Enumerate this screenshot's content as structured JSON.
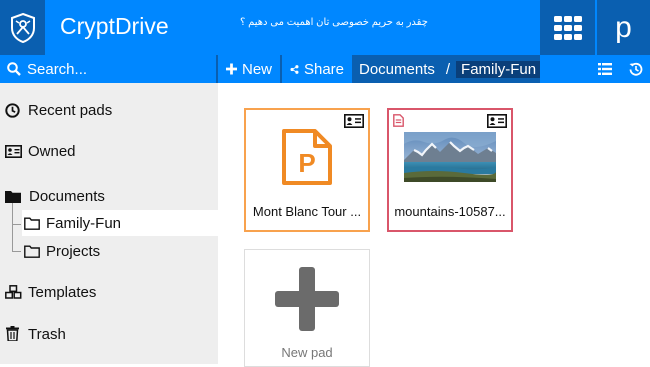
{
  "header": {
    "app_title": "CryptDrive",
    "motto": "چقدر به حریم خصوصی تان اهمیت می دهیم ؟",
    "user_initial": "p"
  },
  "toolbar": {
    "search_placeholder": "Search...",
    "new_label": "New",
    "share_label": "Share",
    "breadcrumb": [
      "Documents",
      "Family-Fun"
    ],
    "breadcrumb_separator": "/"
  },
  "sidebar": {
    "recent": "Recent pads",
    "owned": "Owned",
    "documents": "Documents",
    "subfolders": [
      "Family-Fun",
      "Projects"
    ],
    "templates": "Templates",
    "trash": "Trash"
  },
  "files": [
    {
      "name": "Mont Blanc Tour ...",
      "type": "pad",
      "icon": "pad-file-icon"
    },
    {
      "name": "mountains-10587...",
      "type": "image",
      "icon": "image-file-icon"
    }
  ],
  "new_pad": {
    "label": "New pad"
  },
  "colors": {
    "primary": "#0087ff",
    "primary_dark": "#0a5fb0",
    "crumb_active": "#0a3f7a",
    "pad_orange": "#f8a24e",
    "image_red": "#d9566a",
    "sidebar_bg": "#eeeeee"
  }
}
